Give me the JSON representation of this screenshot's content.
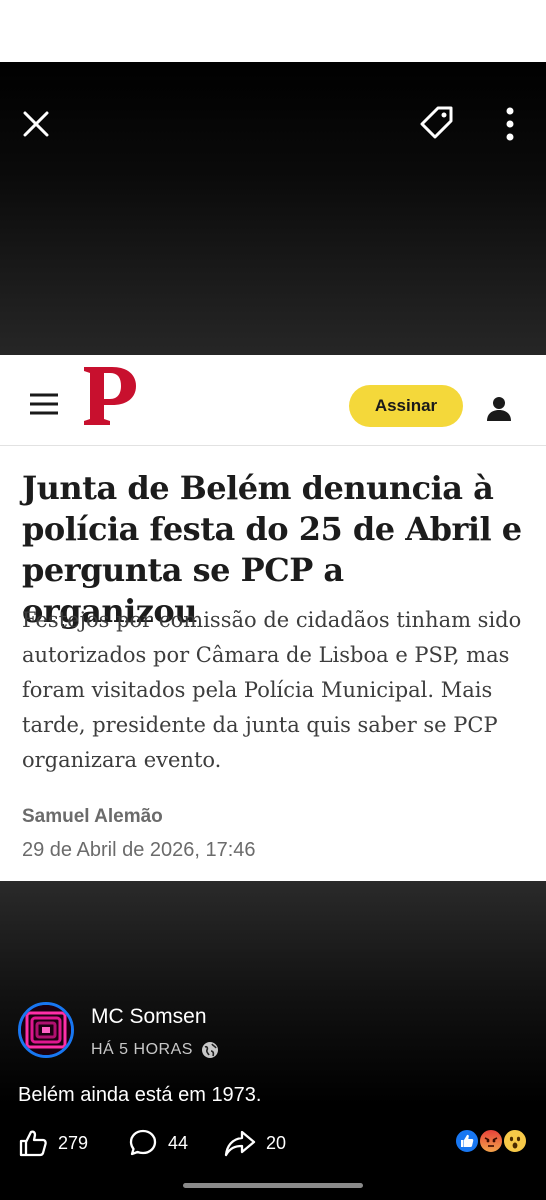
{
  "publication": {
    "subscribe_label": "Assinar"
  },
  "article": {
    "headline": "Junta de Belém denuncia à polícia festa do 25 de Abril e pergunta se PCP a organizou",
    "subtitle": "Festejos por comissão de cidadãos tinham sido autorizados por Câmara de Lisboa e PSP, mas foram visitados pela Polícia Municipal. Mais tarde, presidente da junta quis saber se PCP organizara evento.",
    "author": "Samuel Alemão",
    "date": "29 de Abril de 2026, 17:46"
  },
  "post": {
    "username": "MC Somsen",
    "time": "HÁ 5 HORAS",
    "caption": "Belém ainda está em 1973.",
    "likes": "279",
    "comments": "44",
    "shares": "20"
  },
  "icons": {
    "close": "close-icon",
    "tag": "tag-icon",
    "more": "more-vertical-icon",
    "menu": "hamburger-menu-icon",
    "user": "user-icon",
    "globe": "globe-icon",
    "like": "like-icon",
    "comment": "comment-icon",
    "share": "share-icon"
  },
  "colors": {
    "brand_red": "#c8102e",
    "subscribe_yellow": "#f4d83a",
    "facebook_blue": "#1877f2"
  }
}
